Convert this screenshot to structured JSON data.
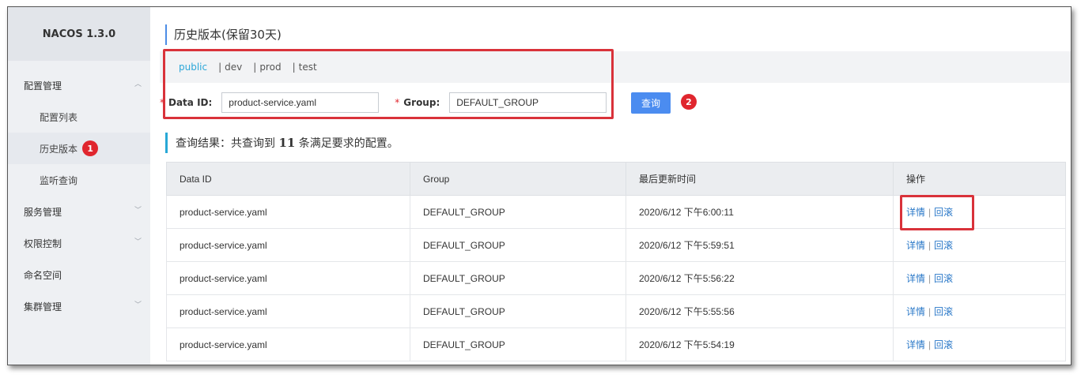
{
  "brand": "NACOS 1.3.0",
  "sidebar": {
    "items": [
      {
        "label": "配置管理"
      },
      {
        "label": "配置列表"
      },
      {
        "label": "历史版本",
        "badge": "1"
      },
      {
        "label": "监听查询"
      },
      {
        "label": "服务管理"
      },
      {
        "label": "权限控制"
      },
      {
        "label": "命名空间"
      },
      {
        "label": "集群管理"
      }
    ]
  },
  "page_title": "历史版本(保留30天)",
  "namespaces": [
    "public",
    "dev",
    "prod",
    "test"
  ],
  "filter": {
    "data_id_label": "Data ID:",
    "data_id_value": "product-service.yaml",
    "group_label": "Group:",
    "group_value": "DEFAULT_GROUP",
    "query_button": "查询",
    "badge": "2"
  },
  "result": {
    "prefix": "查询结果：共查询到",
    "count": "11",
    "suffix": "条满足要求的配置。"
  },
  "table": {
    "headers": [
      "Data ID",
      "Group",
      "最后更新时间",
      "操作"
    ],
    "rows": [
      {
        "data_id": "product-service.yaml",
        "group": "DEFAULT_GROUP",
        "time": "2020/6/12 下午6:00:11"
      },
      {
        "data_id": "product-service.yaml",
        "group": "DEFAULT_GROUP",
        "time": "2020/6/12 下午5:59:51"
      },
      {
        "data_id": "product-service.yaml",
        "group": "DEFAULT_GROUP",
        "time": "2020/6/12 下午5:56:22"
      },
      {
        "data_id": "product-service.yaml",
        "group": "DEFAULT_GROUP",
        "time": "2020/6/12 下午5:55:56"
      },
      {
        "data_id": "product-service.yaml",
        "group": "DEFAULT_GROUP",
        "time": "2020/6/12 下午5:54:19"
      }
    ],
    "actions": {
      "detail": "详情",
      "separator": "|",
      "rollback": "回滚"
    }
  },
  "colors": {
    "accent": "#4b8cf0",
    "highlight": "#d9323a",
    "link": "#2a78c8"
  }
}
